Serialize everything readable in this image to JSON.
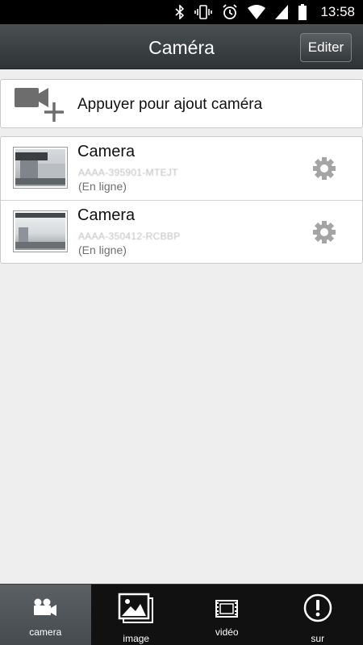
{
  "status_bar": {
    "time": "13:58"
  },
  "header": {
    "title": "Caméra",
    "edit_label": "Editer"
  },
  "add_camera": {
    "label": "Appuyer pour ajout caméra"
  },
  "cameras": [
    {
      "name": "Camera",
      "id": "AAAA-395901-MTEJT",
      "status": "(En ligne)"
    },
    {
      "name": "Camera",
      "id": "AAAA-350412-RCBBP",
      "status": "(En ligne)"
    }
  ],
  "tabs": [
    {
      "label": "camera",
      "icon": "video-camera-icon",
      "active": true
    },
    {
      "label": "image",
      "icon": "picture-icon",
      "active": false
    },
    {
      "label": "vidéo",
      "icon": "film-icon",
      "active": false
    },
    {
      "label": "sur",
      "icon": "info-icon",
      "active": false
    }
  ],
  "colors": {
    "header": "#3b4042",
    "background": "#eeeeee",
    "tab_active": "#50555a"
  }
}
